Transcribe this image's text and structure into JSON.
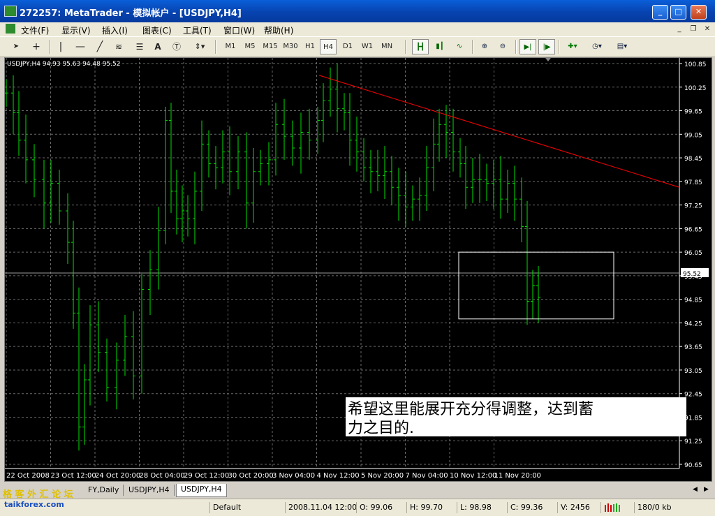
{
  "window": {
    "title": "272257: MetaTrader - 模拟帐户 - [USDJPY,H4]",
    "buttons": {
      "minimize": "_",
      "maximize": "□",
      "close": "✕"
    }
  },
  "menu": {
    "items": [
      "文件(F)",
      "显示(V)",
      "插入(I)",
      "图表(C)",
      "工具(T)",
      "窗口(W)",
      "帮助(H)"
    ]
  },
  "toolbar": {
    "timeframes": [
      "M1",
      "M5",
      "M15",
      "M30",
      "H1",
      "H4",
      "D1",
      "W1",
      "MN"
    ],
    "active_timeframe": "H4",
    "text_tool": "A"
  },
  "chart": {
    "info": "USDJPY,H4  94.93 95.63 94.48 95.52",
    "price_ticks": [
      "100.85",
      "100.25",
      "99.65",
      "99.05",
      "98.45",
      "97.85",
      "97.25",
      "96.65",
      "96.05",
      "95.45",
      "94.85",
      "94.25",
      "93.65",
      "93.05",
      "92.45",
      "91.85",
      "91.25",
      "90.65"
    ],
    "current_price": "95.52",
    "date_ticks": [
      "22 Oct 2008",
      "23 Oct 12:00",
      "24 Oct 20:00",
      "28 Oct 04:00",
      "29 Oct 12:00",
      "30 Oct 20:00",
      "3 Nov 04:00",
      "4 Nov 12:00",
      "5 Nov 20:00",
      "7 Nov 04:00",
      "10 Nov 12:00",
      "11 Nov 20:00"
    ],
    "annotation_line1": "希望这里能展开充分得调整，达到蓄",
    "annotation_line2": "力之目的.",
    "bar_color": "#00e000",
    "trendline_color": "#ff0000",
    "grid_color": "#6a6a6a"
  },
  "tabs": [
    "FY,Daily",
    "USDJPY,H4",
    "USDJPY,H4"
  ],
  "active_tab": 2,
  "status": {
    "profile": "Default",
    "datetime": "2008.11.04 12:00",
    "open": "O: 99.06",
    "high": "H: 99.70",
    "low": "L: 98.98",
    "close": "C: 99.36",
    "volume": "V: 2456",
    "traffic": "180/0 kb"
  },
  "watermark": {
    "line1": "格 客 外 汇 论 坛",
    "line2": "taikforex.com"
  }
}
